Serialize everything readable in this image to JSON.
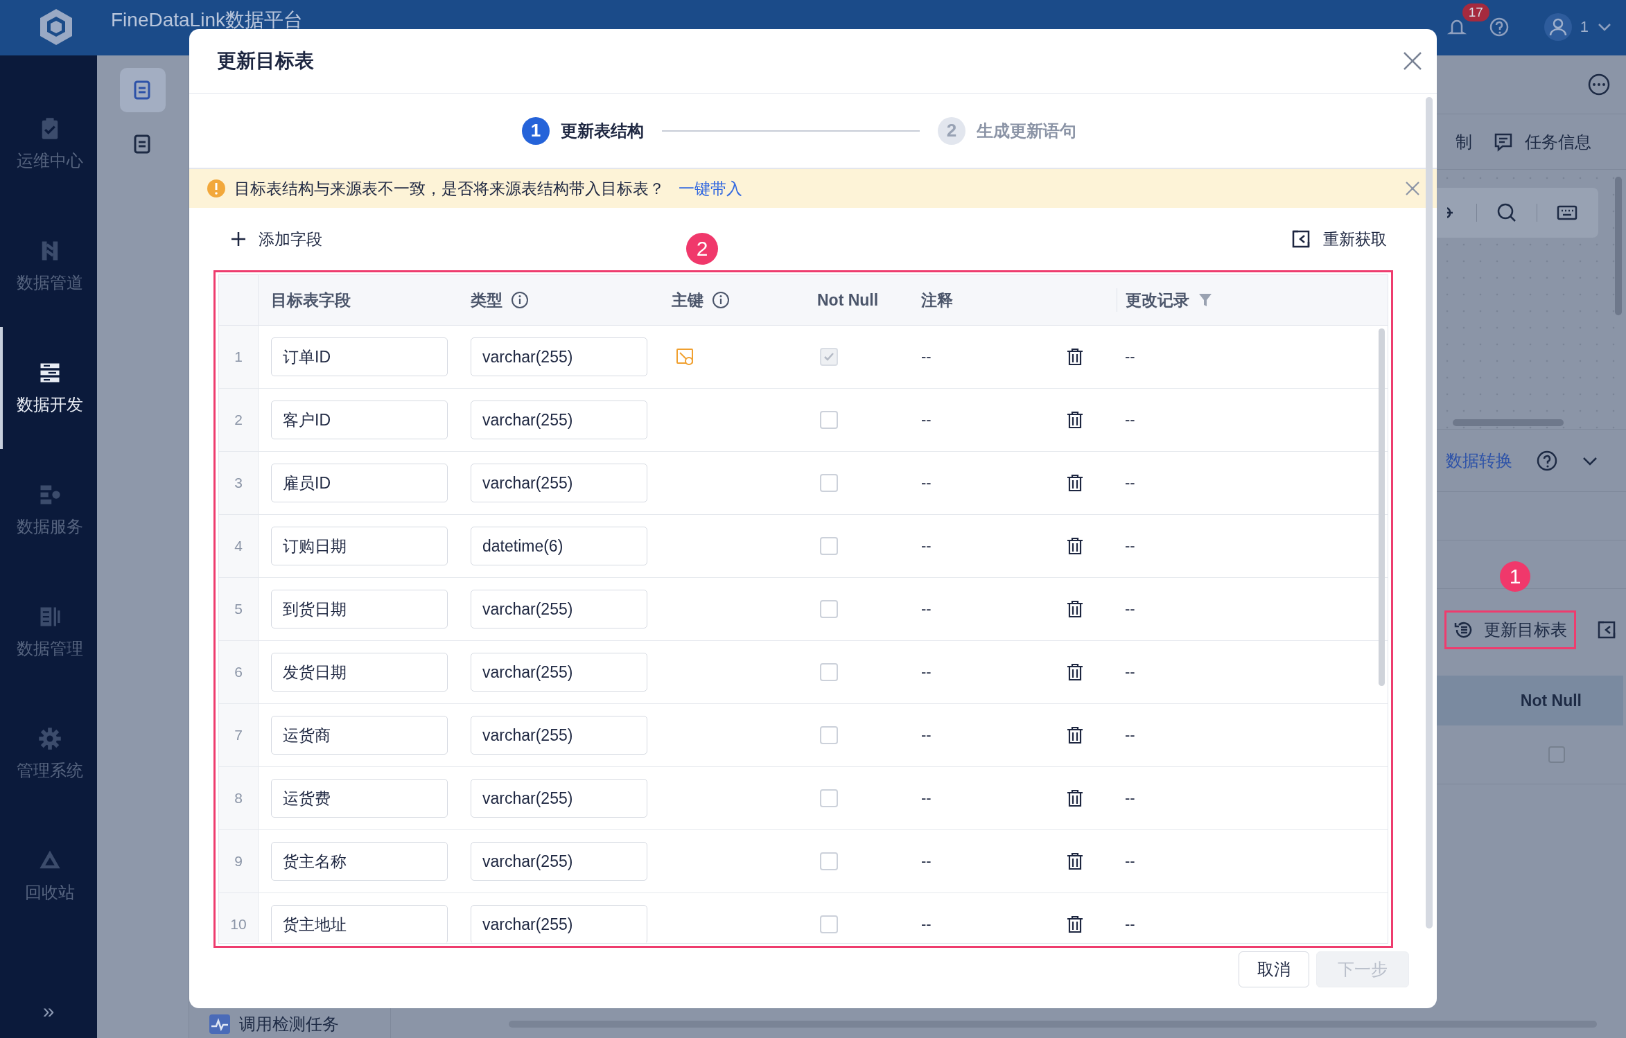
{
  "app": {
    "title": "FineDataLink数据平台",
    "notification_count": "17",
    "user": "1"
  },
  "sidebar": {
    "items": [
      {
        "label": "运维中心",
        "selected": false
      },
      {
        "label": "数据管道",
        "selected": false
      },
      {
        "label": "数据开发",
        "selected": true
      },
      {
        "label": "数据服务",
        "selected": false
      },
      {
        "label": "数据管理",
        "selected": false
      },
      {
        "label": "管理系统",
        "selected": false
      },
      {
        "label": "回收站",
        "selected": false
      }
    ],
    "collapse": "»"
  },
  "subnav": [
    {
      "selected": true
    },
    {
      "selected": false
    }
  ],
  "background": {
    "tab_partial": "制",
    "task_info_tab": "任务信息",
    "transform_link": "数据转换",
    "update_button": "更新目标表",
    "column_header": "Not Null",
    "not_null_checked": false,
    "task_name": "调用检测任务"
  },
  "dialog": {
    "title": "更新目标表",
    "steps": [
      {
        "number": "1",
        "label": "更新表结构",
        "selected": true
      },
      {
        "number": "2",
        "label": "生成更新语句",
        "selected": false
      }
    ],
    "alert": {
      "message": "目标表结构与来源表不一致，是否将来源表结构带入目标表？",
      "link": "一键带入"
    },
    "add_field": "添加字段",
    "refetch": "重新获取",
    "columns": [
      {
        "label": "目标表字段",
        "info": false,
        "filter": false
      },
      {
        "label": "类型",
        "info": true,
        "filter": false
      },
      {
        "label": "主键",
        "info": true,
        "filter": false
      },
      {
        "label": "Not Null",
        "info": false,
        "filter": false
      },
      {
        "label": "注释",
        "info": false,
        "filter": false
      },
      {
        "label": "更改记录",
        "info": false,
        "filter": true
      }
    ],
    "rows": [
      {
        "index": "1",
        "field": "订单ID",
        "type": "varchar(255)",
        "primary_key": true,
        "not_null": true,
        "comment": "--",
        "change_log": "--"
      },
      {
        "index": "2",
        "field": "客户ID",
        "type": "varchar(255)",
        "primary_key": false,
        "not_null": false,
        "comment": "--",
        "change_log": "--"
      },
      {
        "index": "3",
        "field": "雇员ID",
        "type": "varchar(255)",
        "primary_key": false,
        "not_null": false,
        "comment": "--",
        "change_log": "--"
      },
      {
        "index": "4",
        "field": "订购日期",
        "type": "datetime(6)",
        "primary_key": false,
        "not_null": false,
        "comment": "--",
        "change_log": "--"
      },
      {
        "index": "5",
        "field": "到货日期",
        "type": "varchar(255)",
        "primary_key": false,
        "not_null": false,
        "comment": "--",
        "change_log": "--"
      },
      {
        "index": "6",
        "field": "发货日期",
        "type": "varchar(255)",
        "primary_key": false,
        "not_null": false,
        "comment": "--",
        "change_log": "--"
      },
      {
        "index": "7",
        "field": "运货商",
        "type": "varchar(255)",
        "primary_key": false,
        "not_null": false,
        "comment": "--",
        "change_log": "--"
      },
      {
        "index": "8",
        "field": "运货费",
        "type": "varchar(255)",
        "primary_key": false,
        "not_null": false,
        "comment": "--",
        "change_log": "--"
      },
      {
        "index": "9",
        "field": "货主名称",
        "type": "varchar(255)",
        "primary_key": false,
        "not_null": false,
        "comment": "--",
        "change_log": "--"
      },
      {
        "index": "10",
        "field": "货主地址",
        "type": "varchar(255)",
        "primary_key": false,
        "not_null": false,
        "comment": "--",
        "change_log": "--"
      }
    ],
    "buttons": [
      {
        "label": "取消",
        "disabled": false
      },
      {
        "label": "下一步",
        "disabled": true
      }
    ]
  },
  "annotations": [
    {
      "label": "1"
    },
    {
      "label": "2"
    }
  ]
}
